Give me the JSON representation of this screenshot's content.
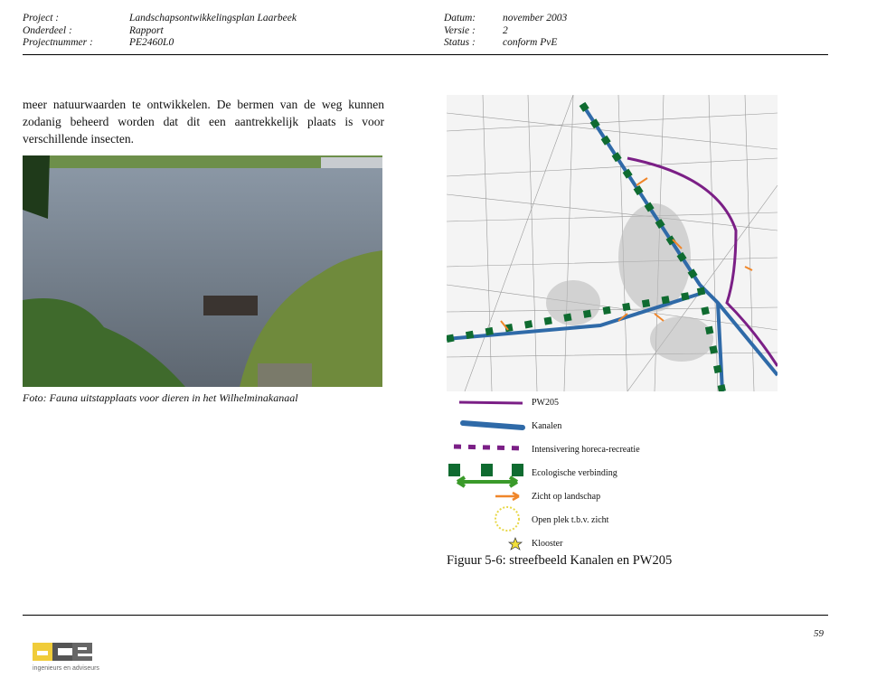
{
  "header": {
    "labels_left": [
      "Project :",
      "Onderdeel :",
      "Projectnummer :"
    ],
    "values_left": [
      "Landschapsontwikkelingsplan Laarbeek",
      "Rapport",
      "PE2460L0"
    ],
    "labels_right": [
      "Datum:",
      "Versie :",
      "Status :"
    ],
    "values_right": [
      "november 2003",
      "2",
      "conform PvE"
    ]
  },
  "body": {
    "paragraph": "meer natuurwaarden te ontwikkelen. De bermen van de weg kunnen zodanig beheerd worden dat dit een aantrekkelijk plaats is voor verschillende insecten.",
    "photo_caption": "Foto: Fauna uitstapplaats voor dieren in het Wilhelminakanaal"
  },
  "figure": {
    "legend": [
      {
        "label": "PW205",
        "color": "#7b1f86"
      },
      {
        "label": "Kanalen",
        "color": "#2f6aa8"
      },
      {
        "label": "Intensivering horeca-recreatie",
        "color": "#7b1f86"
      },
      {
        "label": "Ecologische verbinding",
        "color": "#0f6b30"
      },
      {
        "label": "Zicht op landschap",
        "color": "#f0862a"
      },
      {
        "label": "Open plek t.b.v. zicht",
        "color": "#e8d84a"
      },
      {
        "label": "Klooster",
        "color": "#f2e03a"
      }
    ],
    "caption": "Figuur 5-6: streefbeeld Kanalen en PW205"
  },
  "footer": {
    "page_number": "59",
    "logo_text": "ace",
    "logo_tagline": "ingenieurs en adviseurs"
  }
}
